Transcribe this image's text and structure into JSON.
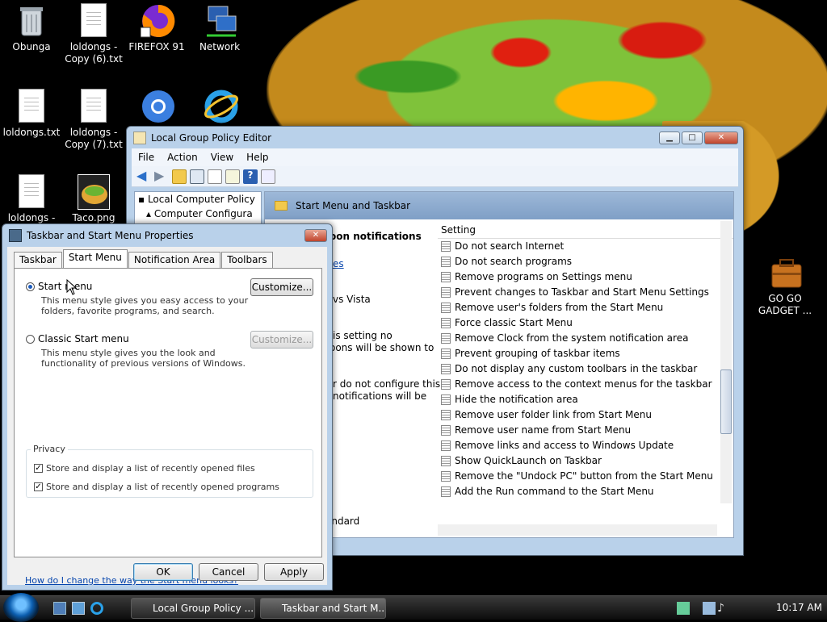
{
  "desktop": {
    "icons": [
      {
        "label": "Obunga"
      },
      {
        "label": "loldongs - Copy (6).txt"
      },
      {
        "label": "FIREFOX 91"
      },
      {
        "label": "Network"
      },
      {
        "label": "loldongs.txt"
      },
      {
        "label": "loldongs - Copy (7).txt"
      },
      {
        "label": "loldongs -"
      },
      {
        "label": "Taco.png"
      },
      {
        "label": "GO GO GADGET ..."
      }
    ]
  },
  "gpe": {
    "title": "Local Group Policy Editor",
    "menu": [
      "File",
      "Action",
      "View",
      "Help"
    ],
    "tree": [
      "Local Computer Policy",
      "Computer Configura"
    ],
    "header": "Start Menu and Taskbar",
    "desc": {
      "line1": "oon notifications",
      "line2": "es",
      "line3": "vs Vista",
      "line4": "is setting no",
      "line5": "oons will be shown to",
      "line6": "r do not configure this",
      "line7": "notifications will be"
    },
    "setting_header": "Setting",
    "settings": [
      "Do not search Internet",
      "Do not search programs",
      "Remove programs on Settings menu",
      "Prevent changes to Taskbar and Start Menu Settings",
      "Remove user's folders from the Start Menu",
      "Force classic Start Menu",
      "Remove Clock from the system notification area",
      "Prevent grouping of taskbar items",
      "Do not display any custom toolbars in the taskbar",
      "Remove access to the context menus for the taskbar",
      "Hide the notification area",
      "Remove user folder link from Start Menu",
      "Remove user name from Start Menu",
      "Remove links and access to Windows Update",
      "Show QuickLaunch on Taskbar",
      "Remove the \"Undock PC\" button from the Start Menu",
      "Add the Run command to the Start Menu"
    ],
    "standard_tab": "andard"
  },
  "dialog": {
    "title": "Taskbar and Start Menu Properties",
    "tabs": [
      "Taskbar",
      "Start Menu",
      "Notification Area",
      "Toolbars"
    ],
    "start_menu_label": "Start menu",
    "start_menu_desc1": "This menu style gives you easy access to your",
    "start_menu_desc2": "folders, favorite programs, and search.",
    "classic_label": "Classic Start menu",
    "classic_desc1": "This menu style gives you the look and",
    "classic_desc2": "functionality of previous versions of Windows.",
    "customize": "Customize...",
    "privacy": "Privacy",
    "store_files": "Store and display a list of recently opened files",
    "store_programs": "Store and display a list of recently opened programs",
    "help_link": "How do I change the way the Start menu looks?",
    "ok": "OK",
    "cancel": "Cancel",
    "apply": "Apply"
  },
  "taskbar": {
    "buttons": [
      "Local Group Policy ...",
      "Taskbar and Start M..."
    ],
    "clock": "10:17 AM"
  }
}
